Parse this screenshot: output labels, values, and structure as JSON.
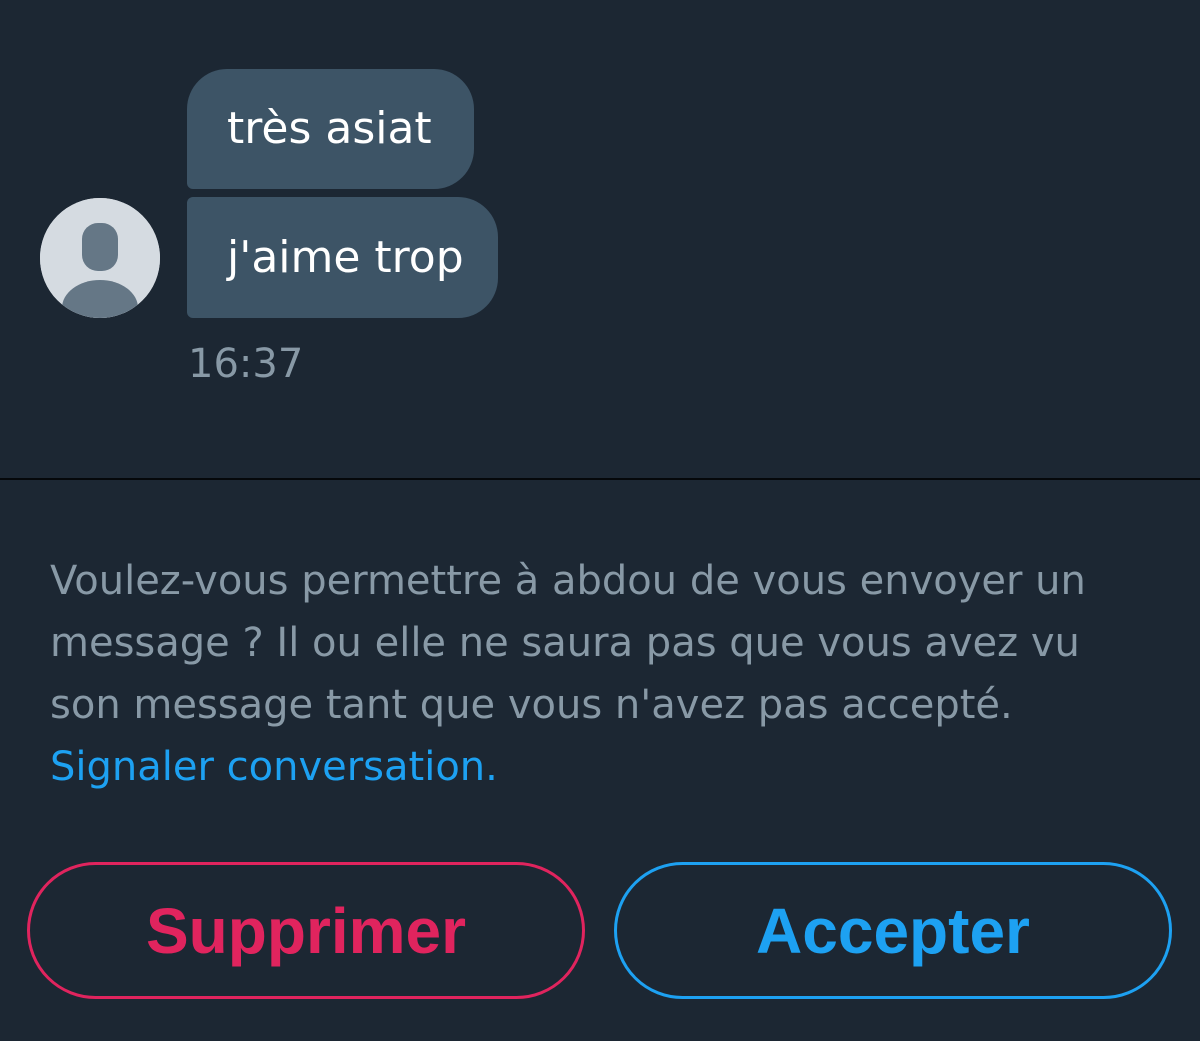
{
  "conversation": {
    "messages": [
      {
        "text": "très asiat"
      },
      {
        "text": "j'aime trop"
      }
    ],
    "timestamp": "16:37",
    "avatar_icon": "default-profile-icon"
  },
  "request": {
    "text": "Voulez-vous permettre à abdou de vous envoyer un message ? Il ou elle ne saura pas que vous avez vu son message tant que vous n'avez pas accepté. ",
    "report_link": "Signaler conversation."
  },
  "actions": {
    "delete_label": "Supprimer",
    "accept_label": "Accepter"
  },
  "colors": {
    "background": "#1c2733",
    "bubble": "#3d5466",
    "secondary_text": "#8899a6",
    "link": "#1da1f2",
    "delete": "#e0245e",
    "accept": "#1da1f2"
  }
}
